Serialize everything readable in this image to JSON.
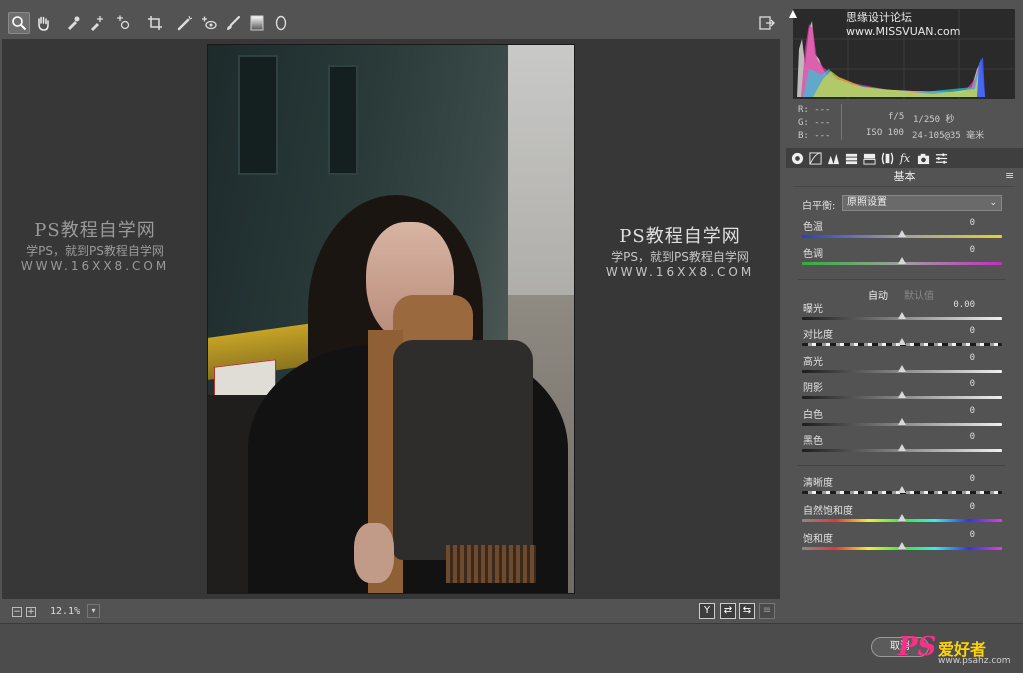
{
  "watermark_left": {
    "title": "PS教程自学网",
    "subtitle": "学PS，就到PS教程自学网",
    "url": "WWW.16XX8.COM"
  },
  "watermark_right": {
    "title": "PS教程自学网",
    "subtitle": "学PS，就到PS教程自学网",
    "url": "WWW.16XX8.COM"
  },
  "toolbar": {
    "tools": [
      "zoom-icon",
      "hand-icon",
      "eyedropper-icon",
      "color-sampler-icon",
      "targeted-adjust-icon",
      "crop-icon",
      "spot-removal-icon",
      "red-eye-icon",
      "adjustment-brush-icon",
      "graduated-filter-icon",
      "radial-filter-icon"
    ],
    "export_icon": "open-object-icon"
  },
  "preview_bar": {
    "zoom_out": "−",
    "zoom_in": "+",
    "zoom_value": "12.1%",
    "views": [
      "Y",
      "⇄",
      "⇆"
    ]
  },
  "histogram": {
    "site_tag": "思缘设计论坛 www.MISSVUAN.com"
  },
  "readout": {
    "r": "R: ---",
    "g": "G: ---",
    "b": "B: ---",
    "aperture": "f/5",
    "shutter": "1/250 秒",
    "iso": "ISO 100",
    "lens": "24-105@35 毫米"
  },
  "panel": {
    "title": "基本",
    "white_balance_label": "白平衡:",
    "white_balance_value": "原照设置",
    "auto_label": "自动",
    "default_label": "默认值",
    "sliders": [
      {
        "label": "色温",
        "value": "0",
        "position": 0.5,
        "track": "temp"
      },
      {
        "label": "色调",
        "value": "0",
        "position": 0.5,
        "track": "tint"
      },
      {
        "label": "曝光",
        "value": "0.00",
        "position": 0.5,
        "track": "gray"
      },
      {
        "label": "对比度",
        "value": "0",
        "position": 0.5,
        "track": "dashed"
      },
      {
        "label": "高光",
        "value": "0",
        "position": 0.5,
        "track": "gray"
      },
      {
        "label": "阴影",
        "value": "0",
        "position": 0.5,
        "track": "gray"
      },
      {
        "label": "白色",
        "value": "0",
        "position": 0.5,
        "track": "gray"
      },
      {
        "label": "黑色",
        "value": "0",
        "position": 0.5,
        "track": "gray"
      },
      {
        "label": "清晰度",
        "value": "0",
        "position": 0.5,
        "track": "dashed"
      },
      {
        "label": "自然饱和度",
        "value": "0",
        "position": 0.5,
        "track": "spectrum"
      },
      {
        "label": "饱和度",
        "value": "0",
        "position": 0.5,
        "track": "spectrum"
      }
    ]
  },
  "footer": {
    "cancel_label": "取消",
    "brand_ps": "PS",
    "brand_cn": "爱好者",
    "brand_url": "www.psahz.com"
  },
  "colors": {
    "panel_bg": "#535353",
    "preview_bg": "#373737",
    "accent_pink": "#ff2d8a",
    "accent_yellow": "#ffd400"
  }
}
